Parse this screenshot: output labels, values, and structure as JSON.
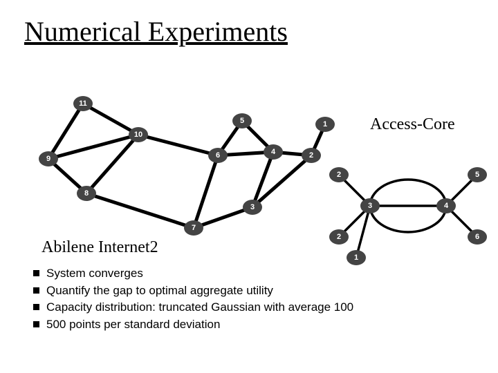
{
  "title": "Numerical Experiments",
  "abilene_label": "Abilene Internet2",
  "access_core_label": "Access-Core",
  "bullets": [
    "System converges",
    "Quantify the gap to optimal aggregate utility",
    "Capacity distribution: truncated Gaussian with average 100",
    "500 points per standard deviation"
  ],
  "abilene_nodes": {
    "n11": "11",
    "n10": "10",
    "n9": "9",
    "n8": "8",
    "n7": "7",
    "n6": "6",
    "n5": "5",
    "n4": "4",
    "n3": "3",
    "n2": "2",
    "n1": "1"
  },
  "access_core_nodes": {
    "a1": "1",
    "a2t": "2",
    "a2b": "2",
    "a3": "3",
    "a4": "4",
    "a5": "5",
    "a6": "6"
  }
}
